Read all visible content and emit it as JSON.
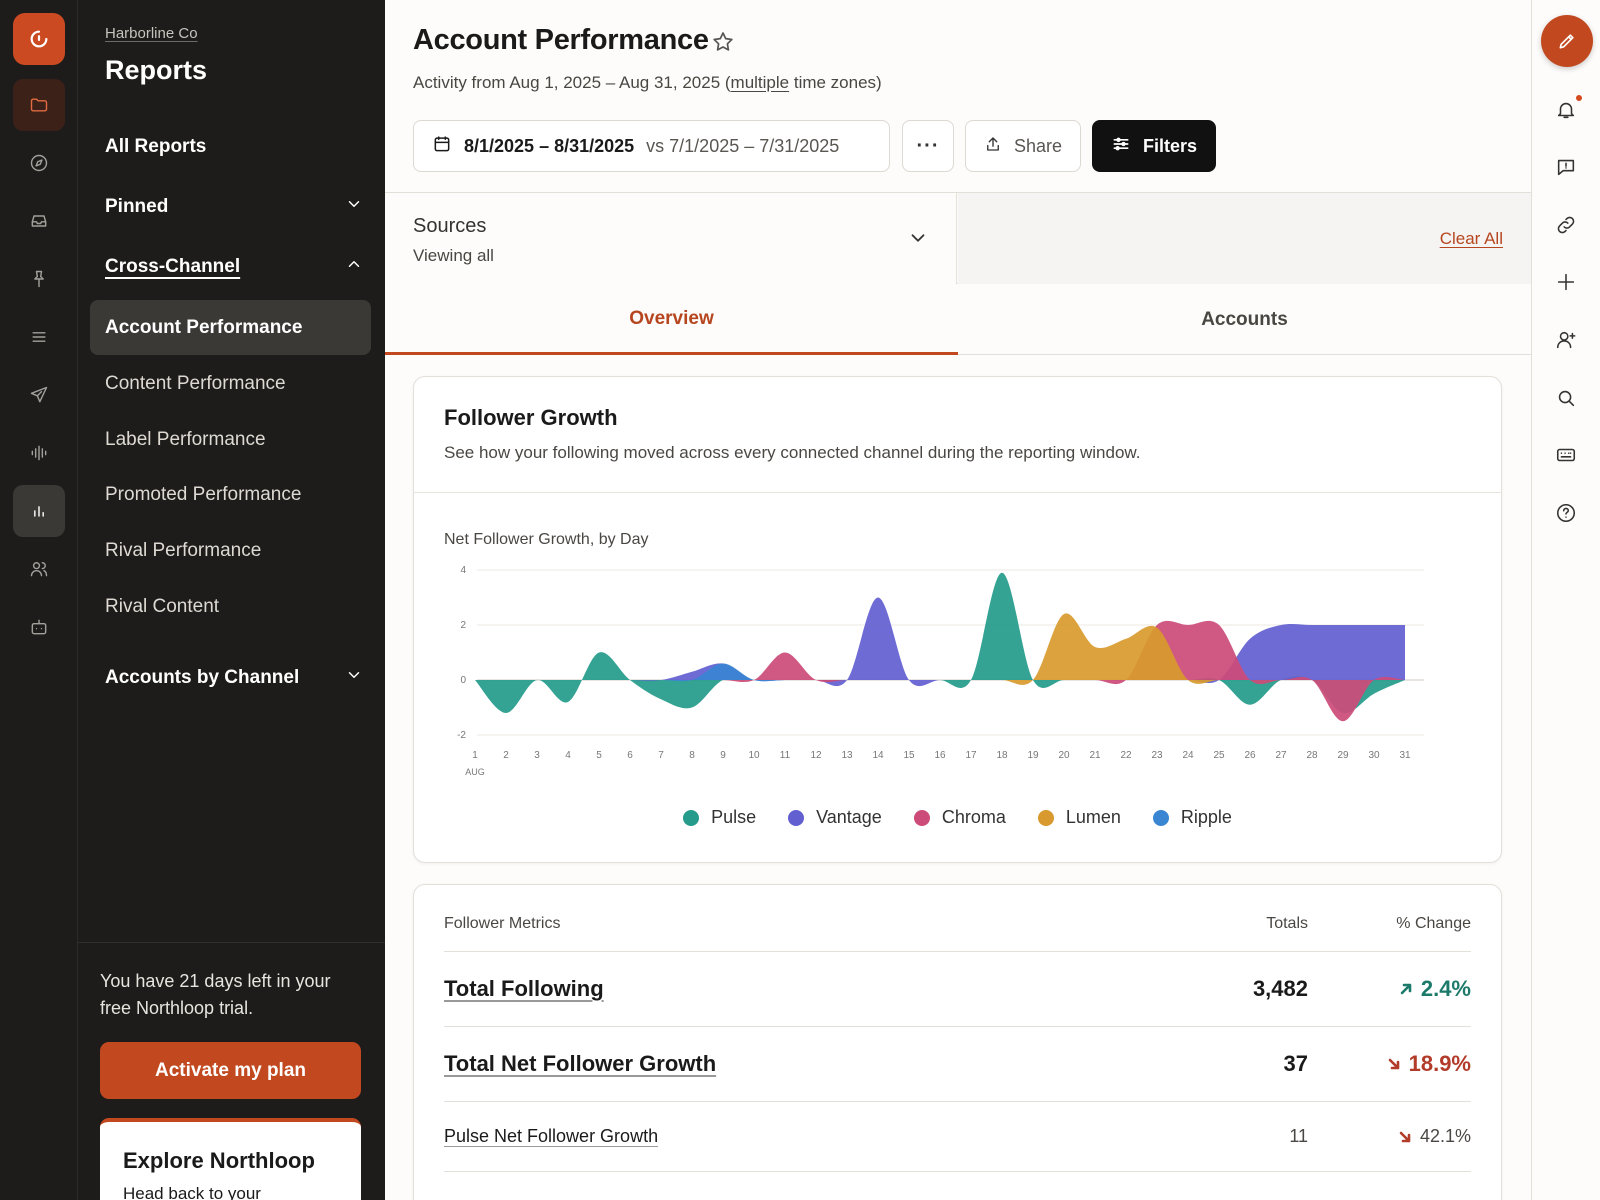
{
  "sidebar": {
    "org": "Harborline Co",
    "title": "Reports",
    "all_reports": "All Reports",
    "pinned": "Pinned",
    "cross_channel": "Cross-Channel",
    "items": [
      {
        "label": "Account Performance",
        "active": true
      },
      {
        "label": "Content Performance"
      },
      {
        "label": "Label Performance"
      },
      {
        "label": "Promoted Performance"
      },
      {
        "label": "Rival Performance"
      },
      {
        "label": "Rival Content"
      }
    ],
    "accounts_by_channel": "Accounts by Channel",
    "trial_text": "You have 21 days left in your free Northloop trial.",
    "activate_label": "Activate my plan",
    "explore_title": "Explore Northloop",
    "explore_sub": "Head back to your"
  },
  "header": {
    "title": "Account Performance",
    "subtitle_prefix": "Activity from Aug 1, 2025 – Aug 31, 2025 (",
    "subtitle_link": "multiple",
    "subtitle_suffix": " time zones)",
    "date_range": "8/1/2025 – 8/31/2025",
    "compare_range": "vs 7/1/2025 – 7/31/2025",
    "more_label": "···",
    "share_label": "Share",
    "filters_label": "Filters"
  },
  "sources": {
    "title": "Sources",
    "subtitle": "Viewing all",
    "clear_all": "Clear All"
  },
  "tabs": [
    {
      "label": "Overview",
      "active": true
    },
    {
      "label": "Accounts"
    }
  ],
  "follower_growth": {
    "title": "Follower Growth",
    "description": "See how your following moved across every connected channel during the reporting window.",
    "chart_label": "Net Follower Growth, by Day"
  },
  "chart_data": {
    "type": "area",
    "title": "Net Follower Growth, by Day",
    "x": [
      1,
      2,
      3,
      4,
      5,
      6,
      7,
      8,
      9,
      10,
      11,
      12,
      13,
      14,
      15,
      16,
      17,
      18,
      19,
      20,
      21,
      22,
      23,
      24,
      25,
      26,
      27,
      28,
      29,
      30,
      31
    ],
    "x_unit_label": "AUG",
    "yticks": [
      4,
      2,
      0,
      -2
    ],
    "ylim": [
      -2,
      4
    ],
    "grid": true,
    "legend_position": "bottom",
    "series": [
      {
        "name": "Pulse",
        "color": "#249b8b",
        "values": [
          0,
          -1.2,
          0,
          -0.8,
          1,
          0,
          -0.7,
          -1,
          0,
          0,
          0,
          0,
          0,
          0,
          0,
          0,
          0,
          3.9,
          0,
          0,
          0,
          0,
          0,
          0,
          0,
          -0.9,
          0,
          0,
          -1.2,
          -0.5,
          0
        ]
      },
      {
        "name": "Vantage",
        "color": "#6260d0",
        "values": [
          0,
          0,
          0,
          0,
          0,
          0,
          0,
          0.3,
          0.6,
          0,
          0,
          0,
          0,
          3,
          0,
          0,
          0,
          0,
          0,
          0,
          0,
          0,
          0,
          0,
          0,
          1.5,
          2,
          2,
          2,
          2,
          2
        ]
      },
      {
        "name": "Chroma",
        "color": "#cc4b78",
        "values": [
          0,
          0,
          0,
          0,
          0,
          0,
          0,
          0,
          0,
          0,
          1,
          0,
          0,
          0,
          0,
          0,
          0,
          0,
          0,
          0,
          0,
          0,
          2,
          2,
          2,
          0,
          0,
          0,
          -1.5,
          0,
          0
        ]
      },
      {
        "name": "Lumen",
        "color": "#d89a2e",
        "values": [
          0,
          0,
          0,
          0,
          0,
          0,
          0,
          0,
          0,
          0,
          0,
          0,
          0,
          0,
          0,
          0,
          0,
          0,
          0,
          2.4,
          1.2,
          1.5,
          1.9,
          0,
          0,
          0,
          0,
          0,
          0,
          0,
          0
        ]
      },
      {
        "name": "Ripple",
        "color": "#3a86d2",
        "values": [
          0,
          0,
          0,
          0,
          0,
          0,
          0,
          0,
          0.6,
          0,
          0,
          0,
          0,
          0,
          0,
          0,
          0,
          0,
          0,
          0,
          0,
          0,
          0,
          0,
          0,
          0,
          0,
          0,
          0,
          0,
          0
        ]
      }
    ]
  },
  "metrics": {
    "header_name": "Follower Metrics",
    "header_totals": "Totals",
    "header_change": "% Change",
    "rows": [
      {
        "name": "Total Following",
        "total": "3,482",
        "change": "2.4%",
        "direction": "up"
      },
      {
        "name": "Total Net Follower Growth",
        "total": "37",
        "change": "18.9%",
        "direction": "down"
      },
      {
        "name": "Pulse Net Follower Growth",
        "total": "11",
        "change": "42.1%",
        "direction": "down"
      }
    ]
  }
}
